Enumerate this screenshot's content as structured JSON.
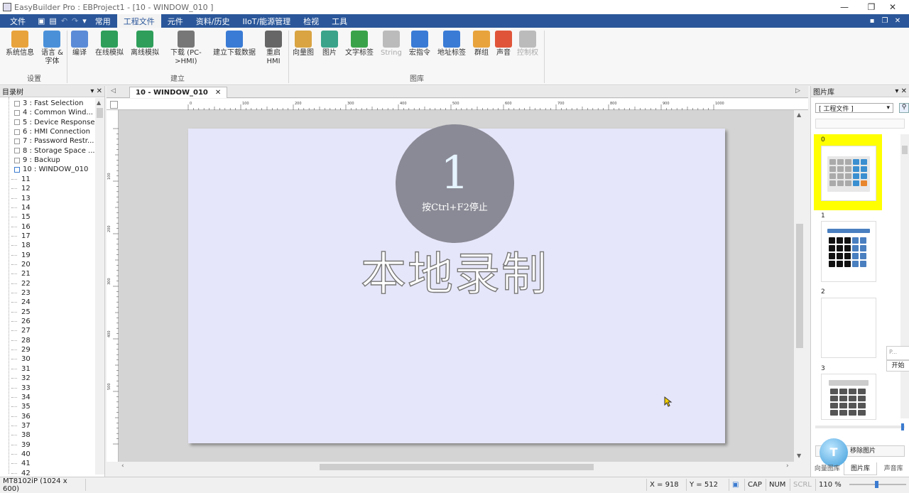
{
  "window": {
    "title": "EasyBuilder Pro : EBProject1 - [10 - WINDOW_010 ]",
    "min": "—",
    "max": "❐",
    "close": "✕"
  },
  "menu": {
    "tabs": [
      "文件",
      "常用",
      "工程文件",
      "元件",
      "资料/历史",
      "IIoT/能源管理",
      "检视",
      "工具"
    ],
    "active_index": 2
  },
  "ribbon": {
    "groups": [
      {
        "label": "设置"
      },
      {
        "label": "建立"
      },
      {
        "label": "图库"
      }
    ],
    "buttons": [
      {
        "label": "系统信息",
        "icon": "system-info-icon",
        "color": "#e8a33c"
      },
      {
        "label": "语言 &\n字体",
        "icon": "language-font-icon",
        "color": "#4a90d9"
      },
      {
        "label": "编译",
        "icon": "compile-icon",
        "color": "#5b8bd6"
      },
      {
        "label": "在线模拟",
        "icon": "online-sim-icon",
        "color": "#2e9e5a"
      },
      {
        "label": "离线模拟",
        "icon": "offline-sim-icon",
        "color": "#2e9e5a"
      },
      {
        "label": "下载 (PC-\n>HMI)",
        "icon": "download-icon",
        "color": "#777"
      },
      {
        "label": "建立下载数据",
        "icon": "sd-card-icon",
        "color": "#3a7bd5"
      },
      {
        "label": "重启\nHMI",
        "icon": "restart-hmi-icon",
        "color": "#666"
      },
      {
        "label": "向量图",
        "icon": "vector-icon",
        "color": "#d9a441"
      },
      {
        "label": "图片",
        "icon": "picture-icon",
        "color": "#3aa38a"
      },
      {
        "label": "文字标签",
        "icon": "tag-icon",
        "color": "#3aa34a"
      },
      {
        "label": "String",
        "icon": "string-icon",
        "color": "#bbb"
      },
      {
        "label": "宏指令",
        "icon": "macro-icon",
        "color": "#3a7bd5"
      },
      {
        "label": "地址标签",
        "icon": "address-tag-icon",
        "color": "#3a7bd5"
      },
      {
        "label": "群组",
        "icon": "group-icon",
        "color": "#e8a33c"
      },
      {
        "label": "声音",
        "icon": "sound-icon",
        "color": "#e0553a"
      },
      {
        "label": "控制权",
        "icon": "lock-icon",
        "color": "#bbb"
      }
    ]
  },
  "tree": {
    "header": "目录树",
    "items": [
      "3 : Fast Selection",
      "4 : Common Wind...",
      "5 : Device Response",
      "6 : HMI Connection",
      "7 : Password Restr...",
      "8 : Storage Space ...",
      "9 : Backup",
      "10 : WINDOW_010",
      "11",
      "12",
      "13",
      "14",
      "15",
      "16",
      "17",
      "18",
      "19",
      "20",
      "21",
      "22",
      "23",
      "24",
      "25",
      "26",
      "27",
      "28",
      "29",
      "30",
      "31",
      "32",
      "33",
      "34",
      "35",
      "36",
      "37",
      "38",
      "39",
      "40",
      "41",
      "42"
    ]
  },
  "document": {
    "tab_label": "10 - WINDOW_010",
    "close": "✕"
  },
  "ruler": {
    "top_marks": [
      "0",
      "100",
      "200",
      "300",
      "400",
      "500",
      "600",
      "700",
      "800",
      "900",
      "1000"
    ],
    "left_marks": [
      "100",
      "200",
      "300",
      "400",
      "500"
    ]
  },
  "recording": {
    "number": "1",
    "hint": "按Ctrl+F2停止",
    "title": "本地录制"
  },
  "image_panel": {
    "header": "图片库",
    "dropdown": "[ 工程文件 ]",
    "items": [
      "0",
      "1",
      "2",
      "3"
    ],
    "remove_button": "移除图片",
    "tabs": [
      "向量图库",
      "图片库",
      "声音库"
    ],
    "popup_text": "P...",
    "popup_button": "开始",
    "watermark": "T"
  },
  "status": {
    "model": "MT8102iP (1024 x 600)",
    "x": "X = 918",
    "y": "Y = 512",
    "cap": "CAP",
    "num": "NUM",
    "scrl": "SCRL",
    "zoom": "110 %"
  }
}
